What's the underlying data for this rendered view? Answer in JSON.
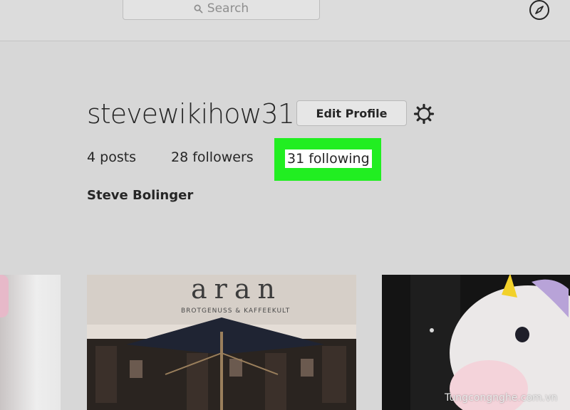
{
  "header": {
    "search_label": "Search",
    "search_icon": "search-icon",
    "explore_icon": "compass-icon"
  },
  "profile": {
    "username": "stevewikihow31",
    "edit_label": "Edit Profile",
    "settings_icon": "gear-icon",
    "posts": "4 posts",
    "followers": "28 followers",
    "following": "31 following",
    "full_name": "Steve Bolinger",
    "highlight_color": "#21ee21"
  },
  "photos": {
    "cafe_sign": "aran",
    "cafe_subtitle": "BROTGENUSS & KAFFEEKULT"
  },
  "watermark": "Tungcongnghe.com.vn"
}
